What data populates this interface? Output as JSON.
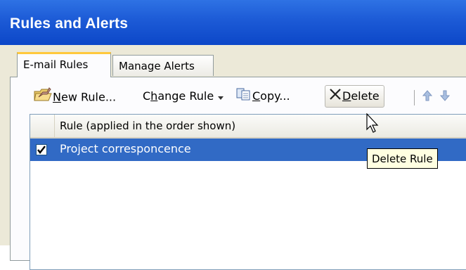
{
  "window": {
    "title": "Rules and Alerts"
  },
  "tabs": [
    {
      "label": "E-mail Rules",
      "active": true
    },
    {
      "label": "Manage Alerts",
      "active": false
    }
  ],
  "toolbar": {
    "new_rule": {
      "pre": "",
      "u": "N",
      "post": "ew Rule..."
    },
    "change_rule": {
      "pre": "C",
      "u": "h",
      "post": "ange Rule"
    },
    "copy": {
      "pre": "",
      "u": "C",
      "post": "opy..."
    },
    "delete": {
      "pre": "",
      "u": "D",
      "post": "elete"
    }
  },
  "list": {
    "column_header": "Rule (applied in the order shown)",
    "rows": [
      {
        "checked": true,
        "name": "Project corresponcence",
        "selected": true
      }
    ]
  },
  "tooltip": {
    "text": "Delete Rule"
  },
  "colors": {
    "titlebar": "#1c5ad6",
    "selection": "#316ac5",
    "tab_highlight": "#ffc83c",
    "tooltip_bg": "#ffffe1"
  }
}
